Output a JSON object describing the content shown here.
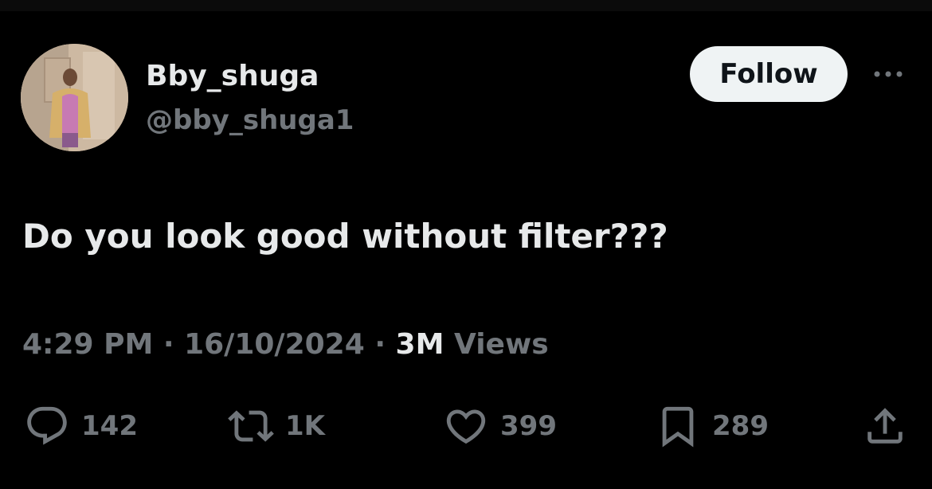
{
  "tweet": {
    "author": {
      "display_name": "Bby_shuga",
      "handle": "@bby_shuga1"
    },
    "follow_label": "Follow",
    "text": "Do you look good without filter???",
    "meta": {
      "time": "4:29 PM",
      "separator": "·",
      "date": "16/10/2024",
      "views_count": "3M",
      "views_label": "Views"
    },
    "actions": {
      "replies": "142",
      "reposts": "1K",
      "likes": "399",
      "bookmarks": "289"
    },
    "icons": [
      "more-icon",
      "reply-icon",
      "repost-icon",
      "like-icon",
      "bookmark-icon",
      "share-icon"
    ]
  },
  "colors": {
    "background": "#000000",
    "text_primary": "#e7e9ea",
    "text_secondary": "#71767b",
    "follow_button_bg": "#eff3f4",
    "follow_button_text": "#0f1419"
  }
}
